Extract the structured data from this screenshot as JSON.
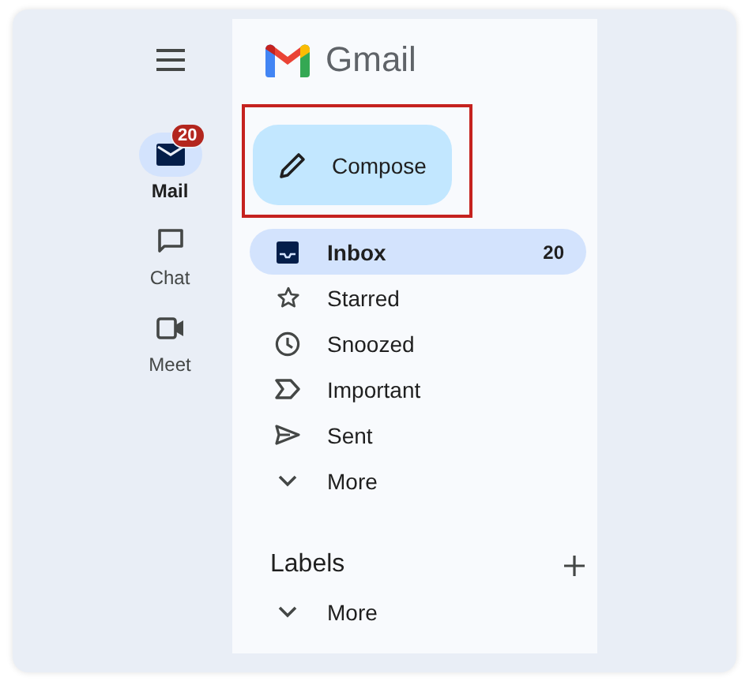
{
  "rail": [
    {
      "label": "Mail",
      "selected": true,
      "badge": "20"
    },
    {
      "label": "Chat",
      "selected": false
    },
    {
      "label": "Meet",
      "selected": false
    }
  ],
  "brand": {
    "name": "Gmail"
  },
  "compose": {
    "label": "Compose",
    "highlighted": true
  },
  "folders": [
    {
      "label": "Inbox",
      "selected": true,
      "count": "20"
    },
    {
      "label": "Starred",
      "selected": false
    },
    {
      "label": "Snoozed",
      "selected": false
    },
    {
      "label": "Important",
      "selected": false
    },
    {
      "label": "Sent",
      "selected": false
    },
    {
      "label": "More",
      "selected": false
    }
  ],
  "labels": {
    "title": "Labels",
    "items": [
      {
        "label": "More"
      }
    ]
  }
}
